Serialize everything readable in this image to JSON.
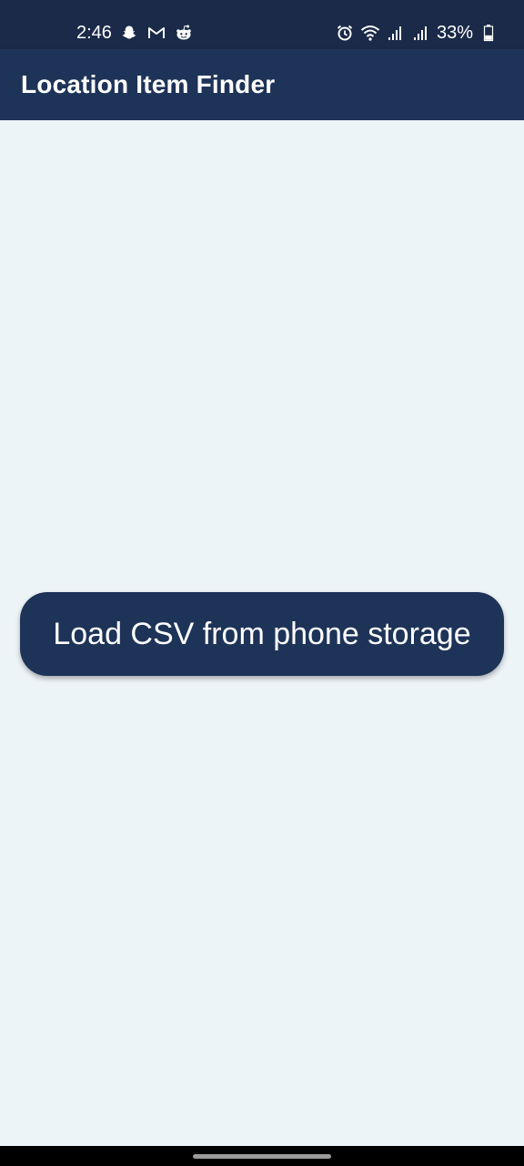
{
  "status_bar": {
    "time": "2:46",
    "battery_percent": "33%",
    "notification_icons": [
      "snapchat-icon",
      "gmail-icon",
      "reddit-icon"
    ],
    "system_icons": [
      "alarm-icon",
      "wifi-icon",
      "signal-icon",
      "signal-icon",
      "battery-icon"
    ]
  },
  "app_bar": {
    "title": "Location Item Finder"
  },
  "main": {
    "load_button_label": "Load CSV from phone storage"
  },
  "colors": {
    "status_bar_bg": "#1a2a48",
    "app_bar_bg": "#1e3358",
    "content_bg": "#edf4f8",
    "button_bg": "#1e3358",
    "text_on_dark": "#ffffff"
  }
}
